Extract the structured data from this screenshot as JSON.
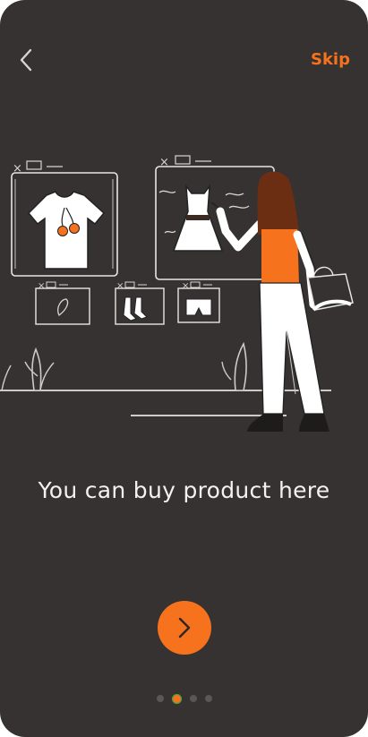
{
  "header": {
    "back_icon": "chevron-left-icon",
    "skip_label": "Skip"
  },
  "onboarding": {
    "headline": "You can buy product here",
    "next_icon": "chevron-right-icon",
    "page_count": 4,
    "active_page": 2
  },
  "colors": {
    "background": "#353231",
    "accent": "#f7721c",
    "text": "#f4f1ee"
  }
}
